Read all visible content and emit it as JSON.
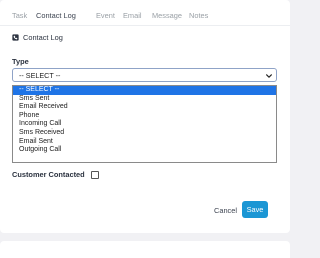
{
  "tabs": [
    "Task",
    "Contact Log",
    "Event",
    "Email",
    "Message",
    "Notes"
  ],
  "active_tab": "Contact Log",
  "section_title": "Contact Log",
  "type_label": "Type",
  "select": {
    "value": "-- SELECT --"
  },
  "dropdown_options": [
    "-- SELECT --",
    "Sms Sent",
    "Email Received",
    "Phone",
    "Incoming Call",
    "Sms Received",
    "Email Sent",
    "Outgoing Call"
  ],
  "customer_contacted_label": "Customer Contacted",
  "customer_contacted_checked": false,
  "cancel_label": "Cancel",
  "save_label": "Save",
  "colors": {
    "accent": "#1b96d4",
    "selected_option": "#1f74e6"
  }
}
